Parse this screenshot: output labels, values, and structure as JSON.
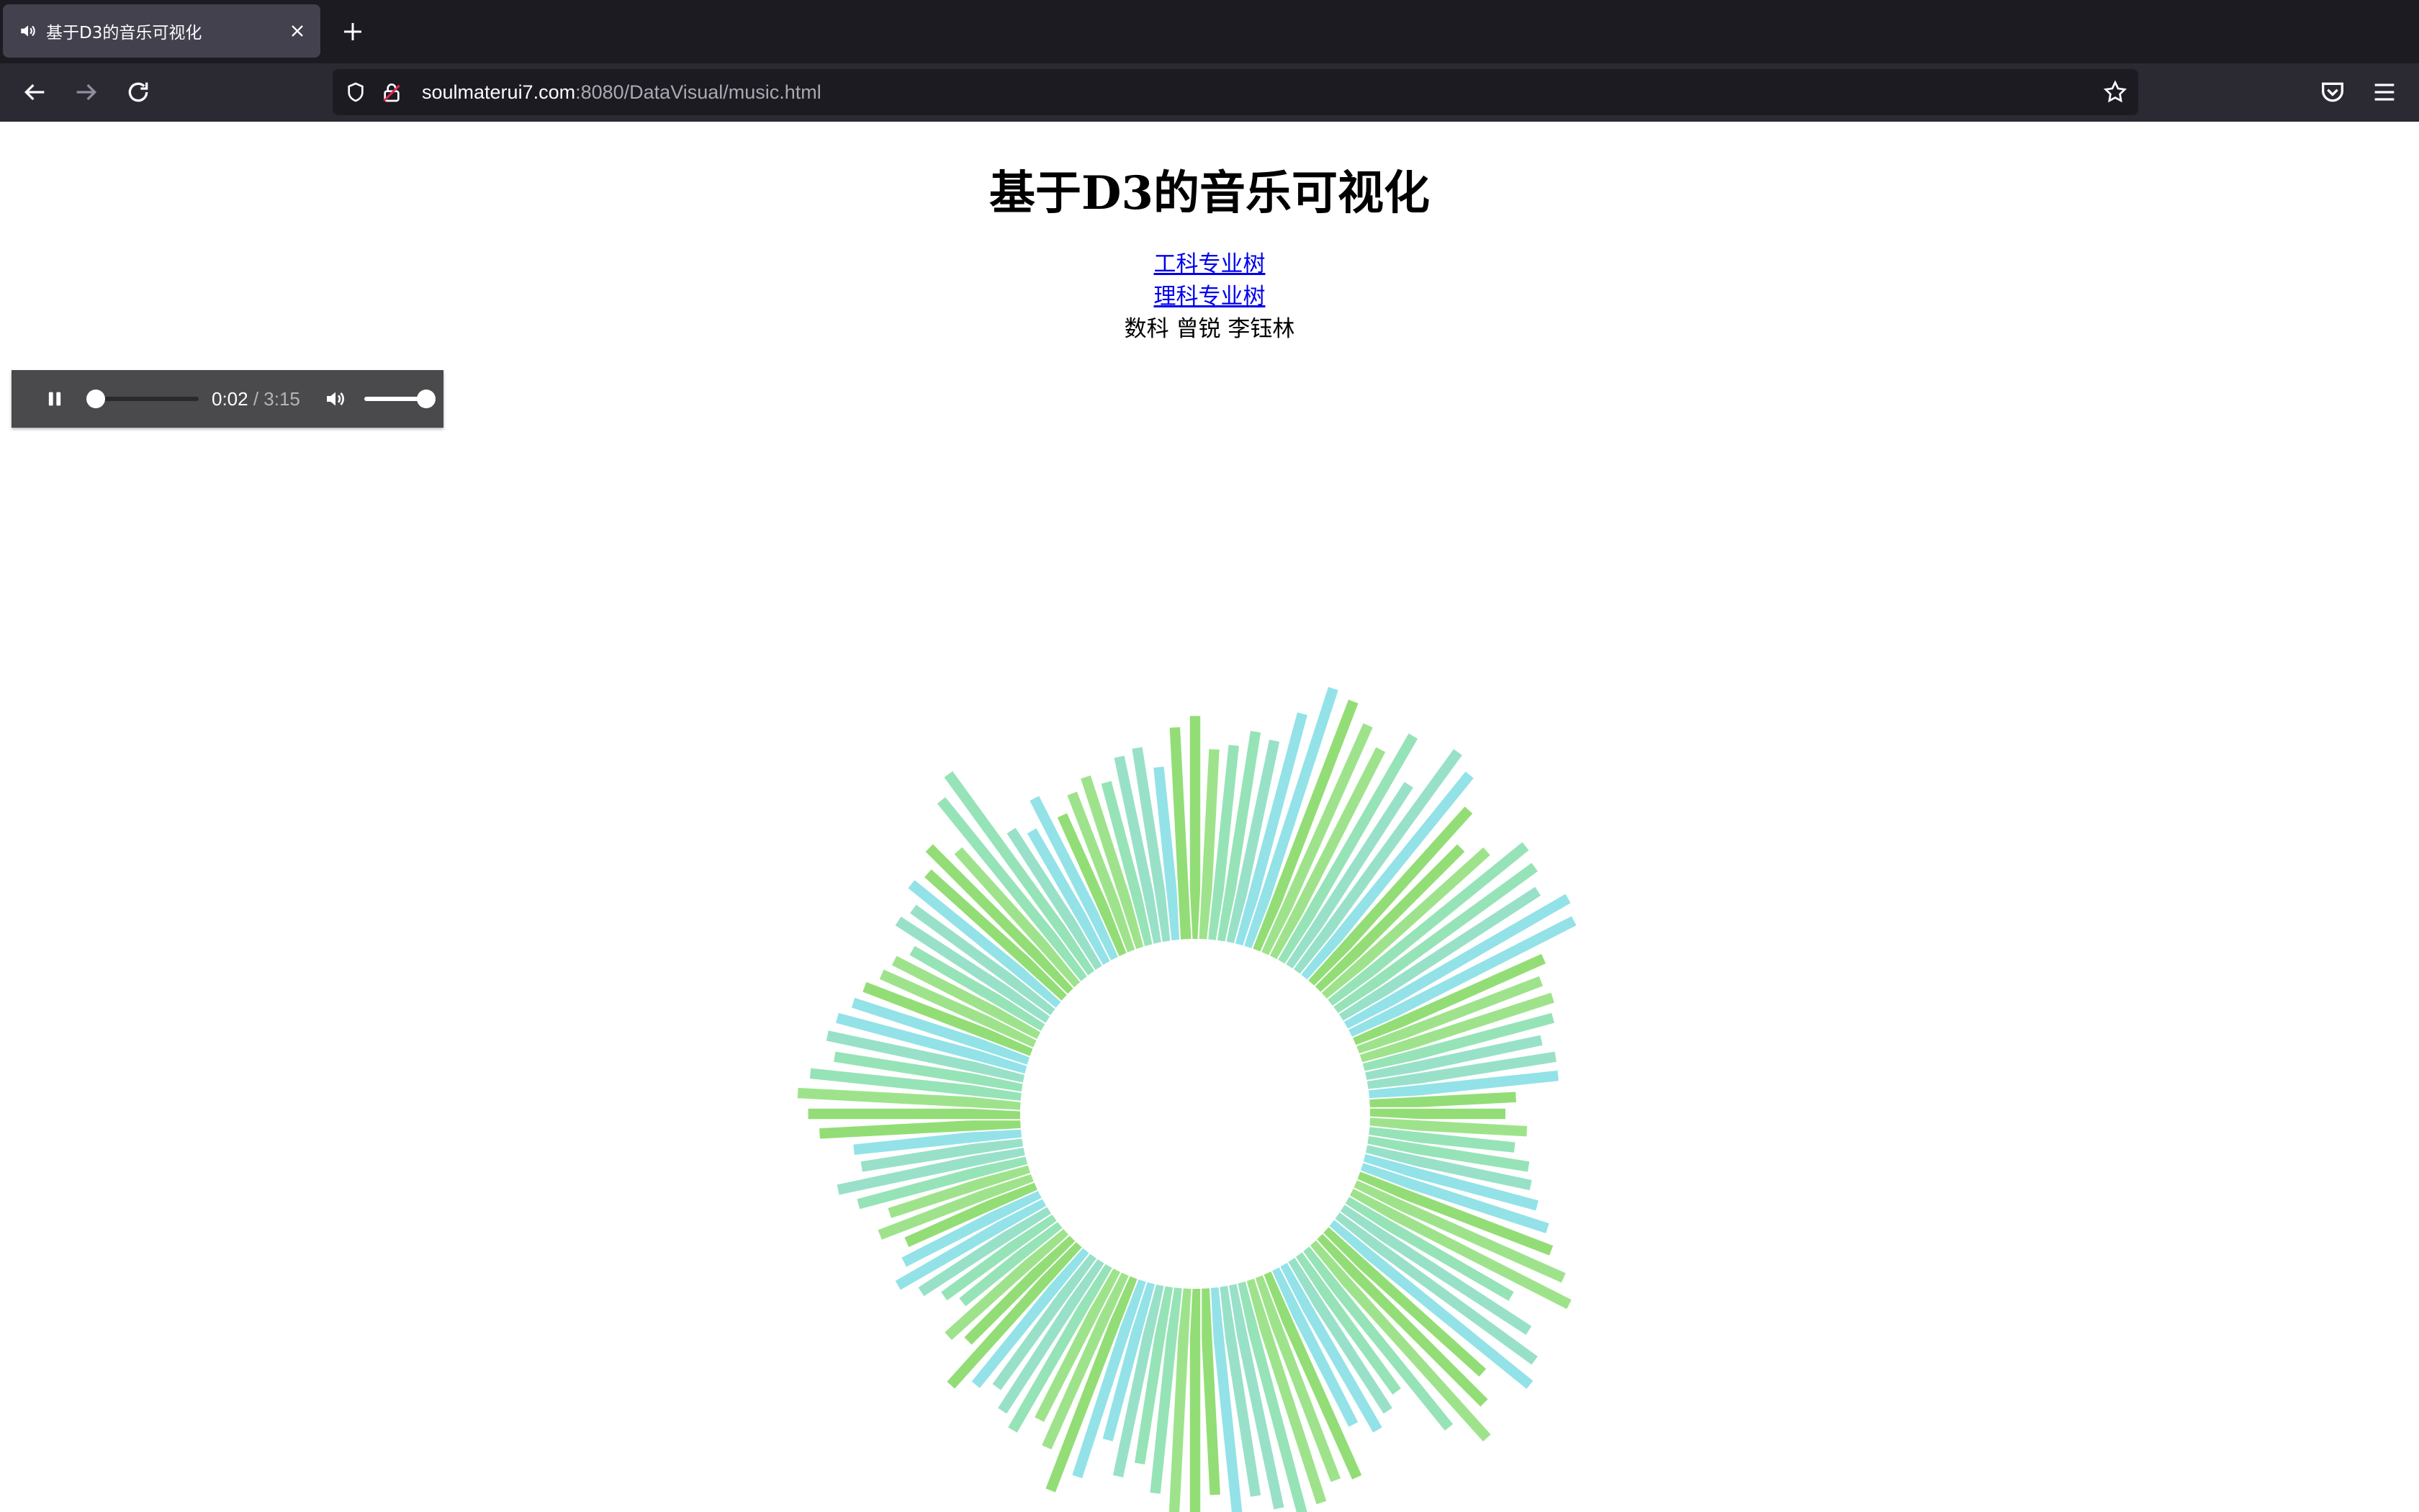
{
  "browser": {
    "tab": {
      "title": "基于D3的音乐可视化",
      "icons": {
        "audio": "speaker-icon",
        "close": "close-icon"
      }
    },
    "new_tab_icon": "plus-icon",
    "nav": {
      "back_icon": "back-arrow-icon",
      "forward_icon": "forward-arrow-icon",
      "reload_icon": "reload-icon",
      "url_host": "soulmaterui7.com",
      "url_path": ":8080/DataVisual/music.html",
      "bookmark_icon": "star-icon",
      "pocket_icon": "pocket-icon",
      "menu_icon": "hamburger-menu-icon"
    }
  },
  "page": {
    "title": "基于D3的音乐可视化",
    "links": [
      {
        "label": "工科专业树"
      },
      {
        "label": "理科专业树"
      }
    ],
    "authors": "数科 曾锐 李钰林"
  },
  "player": {
    "state": "playing",
    "current_time": "0:02",
    "separator": " / ",
    "duration": "3:15",
    "progress_fraction": 0.01,
    "volume_fraction": 1.0,
    "icons": {
      "pause": "pause-icon",
      "volume": "volume-icon"
    }
  },
  "colors": {
    "chrome_dark": "#1c1b22",
    "chrome_nav": "#2b2a33",
    "tab_active": "#42414d",
    "link": "#0000ee",
    "viz_palette": [
      "#93dd76",
      "#96e3b7",
      "#93e2e8",
      "#9ee38c",
      "#98e1c8"
    ]
  },
  "visualization": {
    "type": "radial-frequency-bars",
    "bar_count": 120,
    "levels": [
      0.82,
      0.7,
      0.72,
      0.78,
      0.76,
      0.88,
      1.0,
      0.98,
      0.92,
      0.86,
      0.96,
      0.8,
      1.0,
      0.96,
      0.86,
      0.74,
      0.8,
      0.92,
      0.9,
      0.86,
      0.94,
      0.92,
      0.76,
      0.72,
      0.74,
      0.72,
      0.66,
      0.7,
      0.7,
      0.54,
      0.5,
      0.58,
      0.54,
      0.6,
      0.62,
      0.66,
      0.72,
      0.76,
      0.84,
      0.9,
      0.7,
      0.82,
      0.9,
      0.94,
      0.78,
      0.86,
      0.96,
      0.84,
      0.62,
      0.66,
      0.7,
      0.64,
      0.82,
      0.8,
      0.86,
      0.92,
      0.84,
      0.78,
      0.88,
      0.76,
      0.9,
      0.86,
      0.76,
      0.66,
      0.72,
      0.6,
      0.76,
      0.84,
      0.7,
      0.62,
      0.7,
      0.66,
      0.6,
      0.64,
      0.7,
      0.54,
      0.58,
      0.46,
      0.5,
      0.56,
      0.62,
      0.56,
      0.52,
      0.6,
      0.54,
      0.64,
      0.7,
      0.6,
      0.62,
      0.74,
      0.78,
      0.82,
      0.78,
      0.7,
      0.74,
      0.72,
      0.68,
      0.66,
      0.62,
      0.6,
      0.56,
      0.66,
      0.64,
      0.7,
      0.68,
      0.74,
      0.66,
      0.84,
      0.9,
      0.6,
      0.56,
      0.66,
      0.56,
      0.62,
      0.66,
      0.62,
      0.7,
      0.72,
      0.64,
      0.78
    ]
  }
}
